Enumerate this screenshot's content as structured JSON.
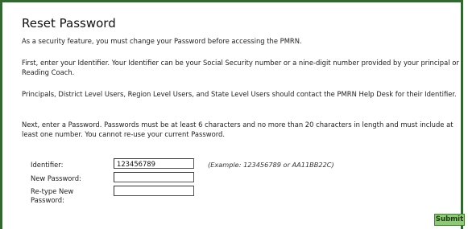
{
  "page": {
    "title": "Reset Password",
    "paragraphs": [
      "As a security feature, you must change your Password before accessing the PMRN.",
      "First, enter your Identifier. Your Identifier can be your Social Security number or a nine-digit number provided by your principal or Reading Coach.",
      "Principals, District Level Users, Region Level Users, and State Level Users should contact the PMRN Help Desk for their Identifier.",
      "Next, enter a Password. Passwords must be at least 6 characters and no more than 20 characters in length and must include at least one number. You cannot re-use your current Password."
    ]
  },
  "form": {
    "identifier_label": "Identifier:",
    "identifier_value": "123456789",
    "identifier_example": "(Example: 123456789 or AA11BB22C)",
    "new_password_label": "New Password:",
    "new_password_value": "",
    "retype_password_label": "Re-type New Password:",
    "retype_password_value": "",
    "submit_label": "Submit"
  },
  "colors": {
    "border": "#336633",
    "submit_bg": "#8ec977"
  }
}
